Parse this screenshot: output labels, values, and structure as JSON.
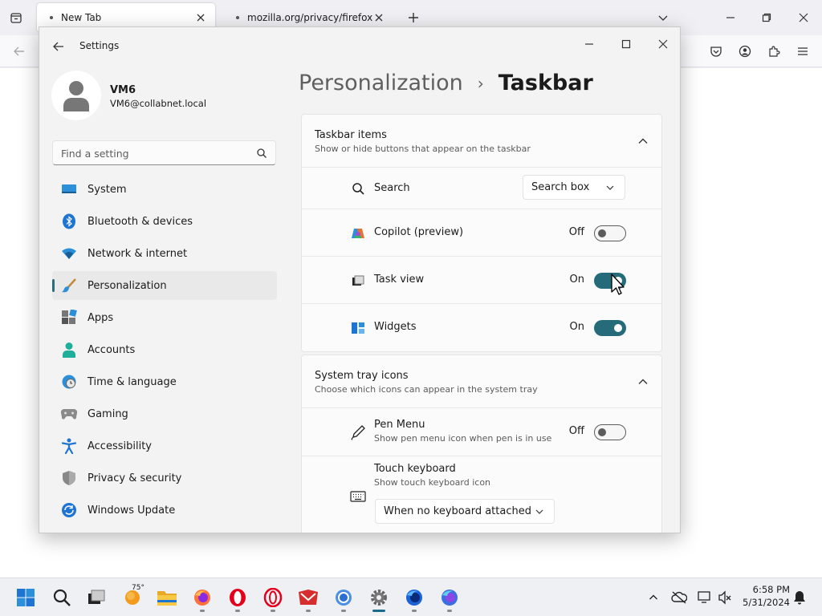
{
  "browser": {
    "tabs": [
      {
        "title": "New Tab",
        "active": true
      },
      {
        "title": "mozilla.org/privacy/firefox/",
        "active": false
      }
    ]
  },
  "settings": {
    "window_title": "Settings",
    "user": {
      "name": "VM6",
      "email": "VM6@collabnet.local"
    },
    "search_placeholder": "Find a setting",
    "nav": [
      {
        "label": "System",
        "icon": "monitor-icon"
      },
      {
        "label": "Bluetooth & devices",
        "icon": "bluetooth-icon"
      },
      {
        "label": "Network & internet",
        "icon": "wifi-icon"
      },
      {
        "label": "Personalization",
        "icon": "brush-icon",
        "selected": true
      },
      {
        "label": "Apps",
        "icon": "apps-icon"
      },
      {
        "label": "Accounts",
        "icon": "person-icon"
      },
      {
        "label": "Time & language",
        "icon": "globe-clock-icon"
      },
      {
        "label": "Gaming",
        "icon": "gamepad-icon"
      },
      {
        "label": "Accessibility",
        "icon": "accessibility-icon"
      },
      {
        "label": "Privacy & security",
        "icon": "shield-icon"
      },
      {
        "label": "Windows Update",
        "icon": "update-icon"
      }
    ],
    "breadcrumb": {
      "parent": "Personalization",
      "separator": "›",
      "current": "Taskbar"
    },
    "taskbar_items": {
      "title": "Taskbar items",
      "description": "Show or hide buttons that appear on the taskbar",
      "search": {
        "label": "Search",
        "value": "Search box"
      },
      "copilot": {
        "label": "Copilot (preview)",
        "state": "Off"
      },
      "task_view": {
        "label": "Task view",
        "state": "On"
      },
      "widgets": {
        "label": "Widgets",
        "state": "On"
      }
    },
    "system_tray": {
      "title": "System tray icons",
      "description": "Choose which icons can appear in the system tray",
      "pen_menu": {
        "label": "Pen Menu",
        "description": "Show pen menu icon when pen is in use",
        "state": "Off"
      },
      "touch_keyboard": {
        "label": "Touch keyboard",
        "description": "Show touch keyboard icon",
        "value": "When no keyboard attached"
      }
    }
  },
  "taskbar": {
    "weather_temp": "75°",
    "time": "6:58 PM",
    "date": "5/31/2024"
  },
  "colors": {
    "accent": "#256b79"
  }
}
